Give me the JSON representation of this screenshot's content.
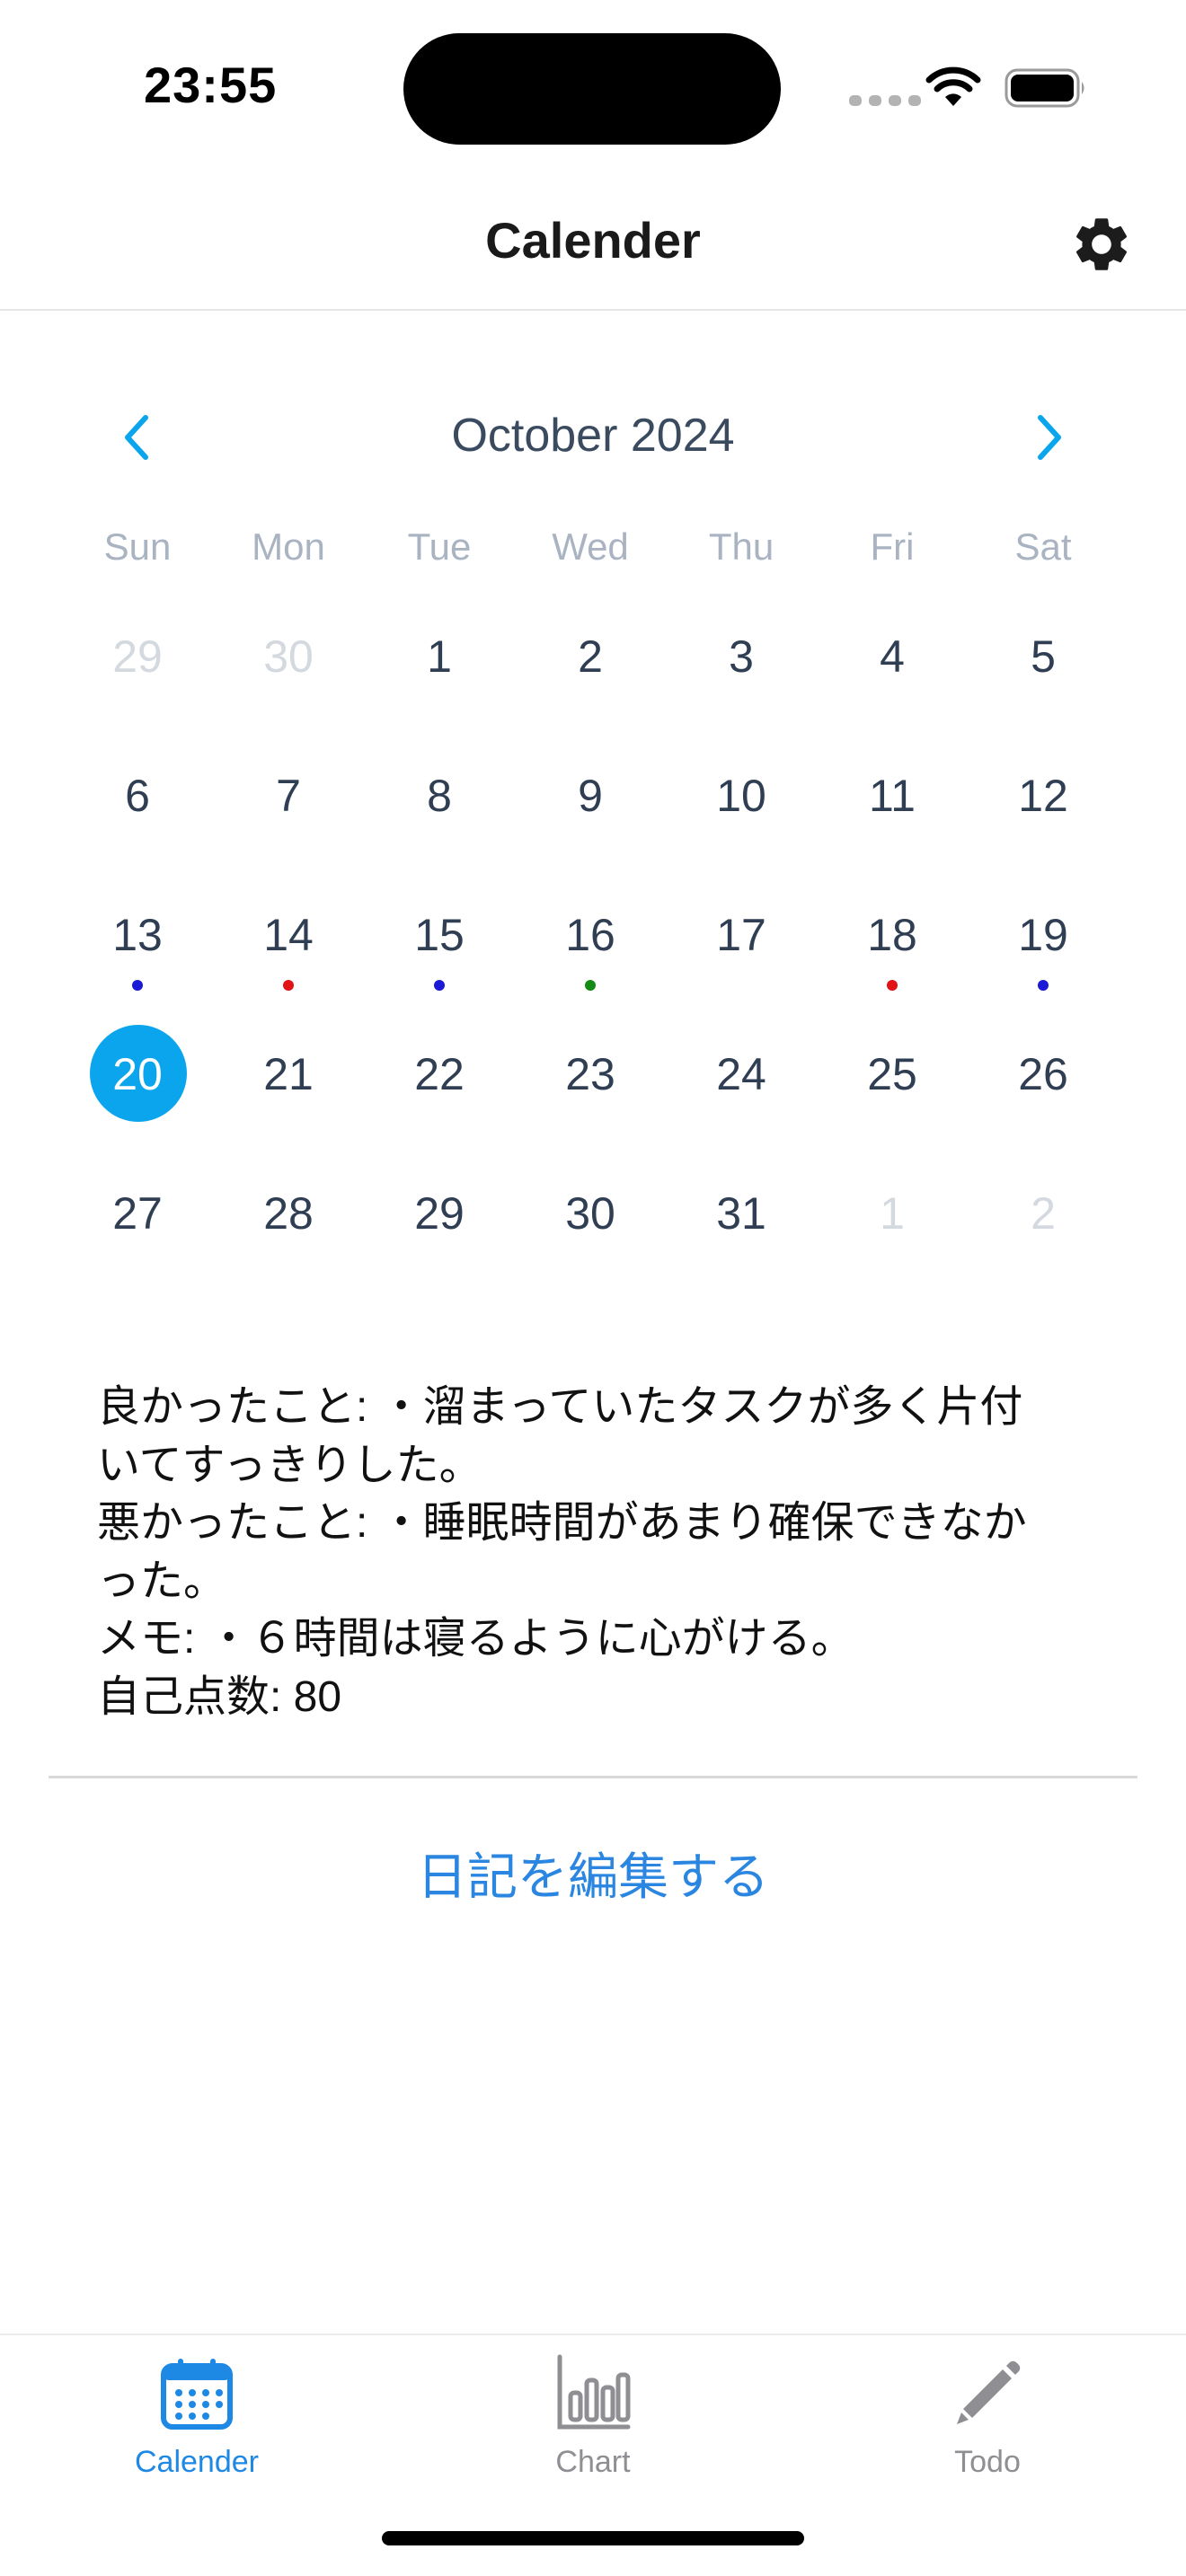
{
  "status_bar": {
    "time": "23:55"
  },
  "nav": {
    "title": "Calender",
    "settings_icon": "gear-icon"
  },
  "calendar": {
    "month_label": "October 2024",
    "weekdays": [
      "Sun",
      "Mon",
      "Tue",
      "Wed",
      "Thu",
      "Fri",
      "Sat"
    ],
    "selected_day": "20",
    "weeks": [
      [
        {
          "d": "29",
          "muted": true
        },
        {
          "d": "30",
          "muted": true
        },
        {
          "d": "1"
        },
        {
          "d": "2"
        },
        {
          "d": "3"
        },
        {
          "d": "4"
        },
        {
          "d": "5"
        }
      ],
      [
        {
          "d": "6"
        },
        {
          "d": "7"
        },
        {
          "d": "8"
        },
        {
          "d": "9"
        },
        {
          "d": "10"
        },
        {
          "d": "11"
        },
        {
          "d": "12"
        }
      ],
      [
        {
          "d": "13",
          "dot": "#1a1ad6"
        },
        {
          "d": "14",
          "dot": "#e01414"
        },
        {
          "d": "15",
          "dot": "#1a1ad6"
        },
        {
          "d": "16",
          "dot": "#138a13"
        },
        {
          "d": "17"
        },
        {
          "d": "18",
          "dot": "#e01414"
        },
        {
          "d": "19",
          "dot": "#1a1ad6"
        }
      ],
      [
        {
          "d": "20",
          "selected": true
        },
        {
          "d": "21"
        },
        {
          "d": "22"
        },
        {
          "d": "23"
        },
        {
          "d": "24"
        },
        {
          "d": "25"
        },
        {
          "d": "26"
        }
      ],
      [
        {
          "d": "27"
        },
        {
          "d": "28"
        },
        {
          "d": "29"
        },
        {
          "d": "30"
        },
        {
          "d": "31"
        },
        {
          "d": "1",
          "muted": true
        },
        {
          "d": "2",
          "muted": true
        }
      ]
    ]
  },
  "diary": {
    "lines": [
      "良かったこと: ・溜まっていたタスクが多く片付",
      "いてすっきりした。",
      "悪かったこと: ・睡眠時間があまり確保できなか",
      "った。",
      "メモ: ・６時間は寝るように心がける。",
      "自己点数: 80"
    ],
    "edit_label": "日記を編集する"
  },
  "tabbar": {
    "tabs": [
      {
        "label": "Calender",
        "icon": "calendar-icon",
        "active": true
      },
      {
        "label": "Chart",
        "icon": "chart-icon",
        "active": false
      },
      {
        "label": "Todo",
        "icon": "pencil-icon",
        "active": false
      }
    ]
  },
  "colors": {
    "accent": "#0aa5ec",
    "link": "#2a86e0",
    "dot_blue": "#1a1ad6",
    "dot_red": "#e01414",
    "dot_green": "#138a13"
  }
}
